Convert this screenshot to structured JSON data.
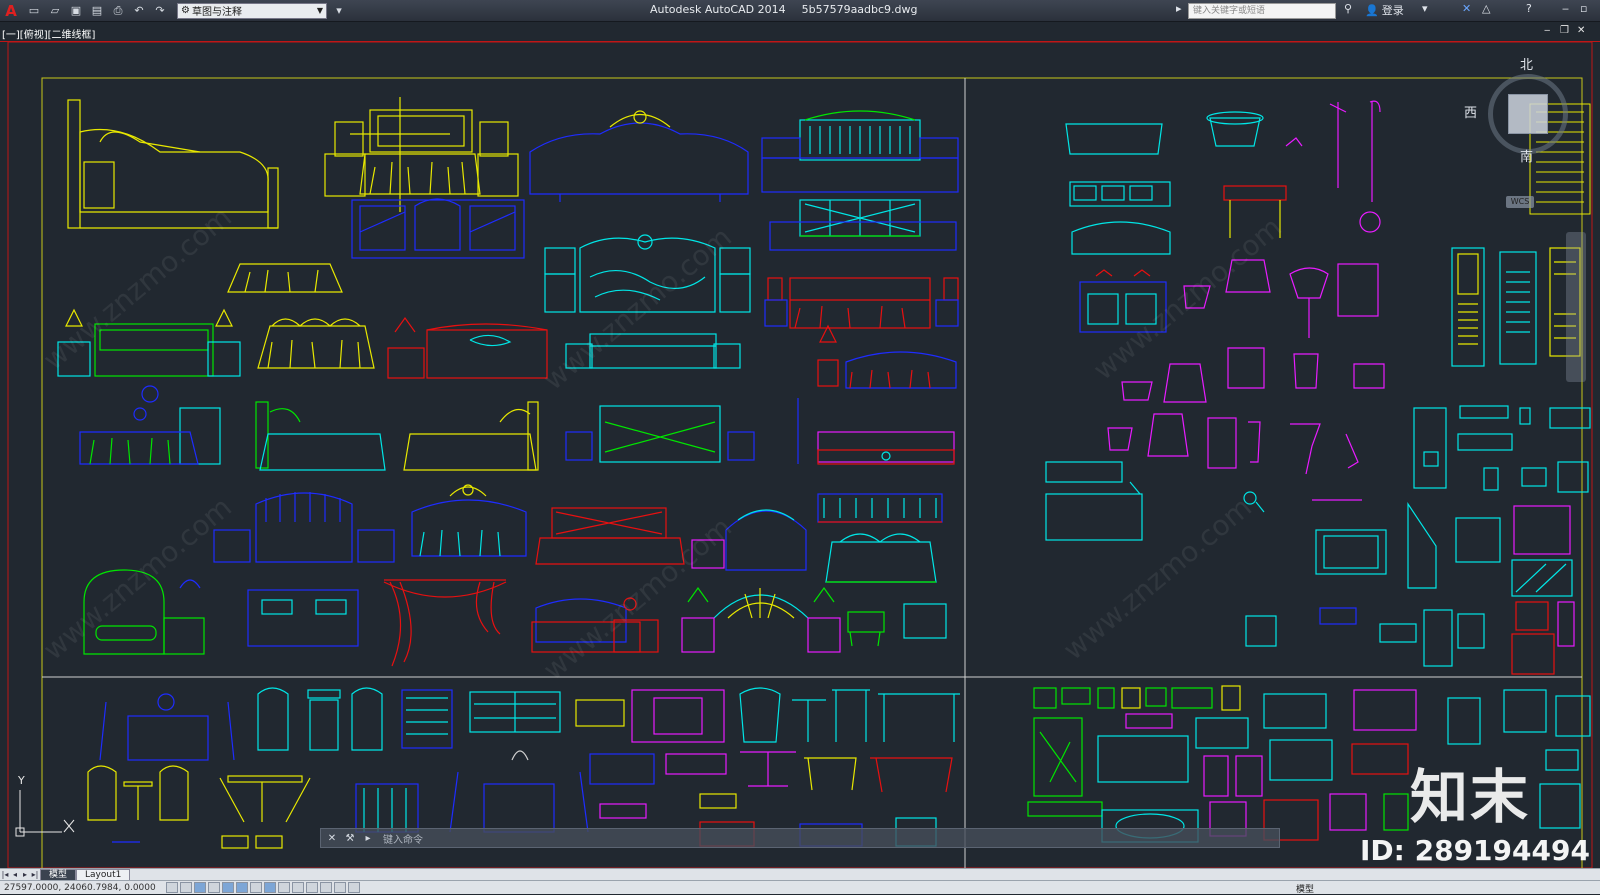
{
  "app": {
    "logo": "A",
    "title": "Autodesk AutoCAD 2014",
    "filename": "5b57579aadbc9.dwg"
  },
  "quick_access": {
    "icons": [
      "new-file-icon",
      "open-file-icon",
      "save-icon",
      "save-as-icon",
      "print-icon",
      "undo-icon",
      "redo-icon"
    ],
    "workspace_value": "草图与注释"
  },
  "search": {
    "placeholder": "键入关键字或短语"
  },
  "account": {
    "login_label": "登录"
  },
  "viewport": {
    "view_label": "[一][俯视][二维线框]"
  },
  "viewcube": {
    "north": "北",
    "west": "西",
    "south": "南",
    "wcs": "WCS"
  },
  "ucs": {
    "y_label": "Y",
    "x_label": "X"
  },
  "command_line": {
    "placeholder": "键入命令"
  },
  "layout_tabs": [
    {
      "label": "模型",
      "active": true
    },
    {
      "label": "Layout1",
      "active": false
    }
  ],
  "statusbar": {
    "coordinates": "27597.0000, 24060.7984, 0.0000",
    "model_label": "模型"
  },
  "watermarks": {
    "site": "www.znzmo.com",
    "brand": "知末",
    "id": "ID: 289194494"
  },
  "colors": {
    "canvas": "#212830",
    "frame_border": "#c8c81a",
    "active_viewport_border": "#c01616",
    "yellow": "#e8e800",
    "blue": "#1e2cff",
    "cyan": "#00e6e6",
    "green": "#00e600",
    "magenta": "#e81cff",
    "red": "#e81010"
  }
}
